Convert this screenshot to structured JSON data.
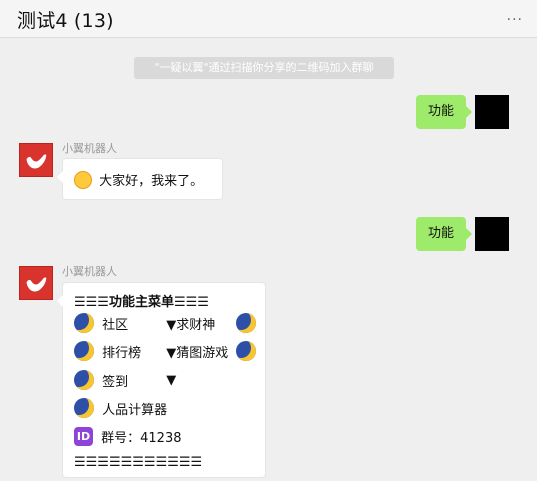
{
  "header": {
    "title": "测试4 (13)",
    "more_icon": "···"
  },
  "system_notice": "\"一疑以翼\"通过扫描你分享的二维码加入群聊",
  "messages": {
    "out1": "功能",
    "bot_name1": "小翼机器人",
    "bot_text1": "大家好，我来了。",
    "out2": "功能",
    "bot_name2": "小翼机器人",
    "menu": {
      "header": "☰☰☰功能主菜单☰☰☰",
      "r1c1": "社区",
      "r1c2": "▼求财神",
      "r2c1": "排行榜",
      "r2c2": "▼猜图游戏",
      "r3c1": "签到",
      "r3c2": "▼",
      "r4c1": "人品计算器",
      "id_label": "ID",
      "group_no": "群号：41238",
      "footer": "☰☰☰☰☰☰☰☰☰☰☰"
    }
  },
  "colors": {
    "out_bubble": "#9eea6a",
    "bot_avatar": "#d9332e",
    "background": "#efefef"
  }
}
